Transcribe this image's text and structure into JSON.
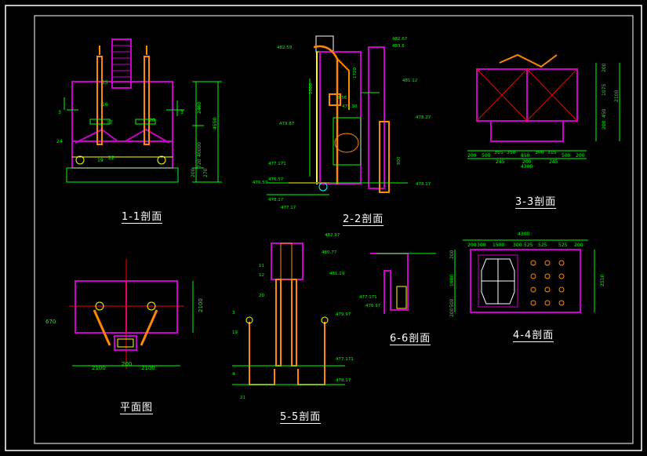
{
  "sections": {
    "s11": "1-1剖面",
    "s22": "2-2剖面",
    "s33": "3-3剖面",
    "plan": "平面图",
    "s55": "5-5剖面",
    "s66": "6-6剖面",
    "s44": "4-4剖面"
  },
  "s11_dims": {
    "a": "2460",
    "b": "4550",
    "c": "40000",
    "d": "720",
    "e": "200",
    "f": "270"
  },
  "s11_tags": [
    "15",
    "16",
    "17",
    "20",
    "22",
    "24",
    "19",
    "3",
    "3"
  ],
  "s22_elev": {
    "e1": "482.59",
    "e2": "482.67",
    "e3": "483.6",
    "e4": "481.12",
    "e5": "479.87",
    "e6": "478.27",
    "e7": "477.171",
    "e8": "476.57",
    "e9": "478.17",
    "e10": "479.30",
    "e11": "476.57",
    "e12": "478.17",
    "e13": "477.17"
  },
  "s22_dims": {
    "a": "1720",
    "b": "3.56",
    "c": "1300",
    "d": "800"
  },
  "s33_dims": {
    "w": "4300",
    "h1": "200",
    "h2": "1075",
    "h3": "200",
    "h4": "2100",
    "h5": "450",
    "row1": [
      "200",
      "500",
      "355",
      "350",
      "850",
      "300",
      "315",
      "500",
      "200"
    ],
    "row2": [
      "245",
      "200",
      "245"
    ]
  },
  "plan_dims": {
    "a": "2100",
    "b": "2100",
    "c": "200",
    "d": "2100",
    "e": "670"
  },
  "s55_elev": {
    "e1": "482.97",
    "e2": "480.77",
    "e3": "481.19",
    "e4": "479.97",
    "e5": "477.171",
    "e6": "478.17"
  },
  "s55_tags": [
    "11",
    "12",
    "20",
    "3",
    "19",
    "4",
    "21"
  ],
  "s66_elev": {
    "e1": "477.171",
    "e2": "476.97"
  },
  "s44_dims": {
    "w": "4300",
    "top": [
      "200",
      "300",
      "1500",
      "300",
      "525",
      "525",
      "525",
      "200"
    ],
    "h": "2510",
    "side": [
      "200",
      "1900",
      "500",
      "200"
    ]
  }
}
